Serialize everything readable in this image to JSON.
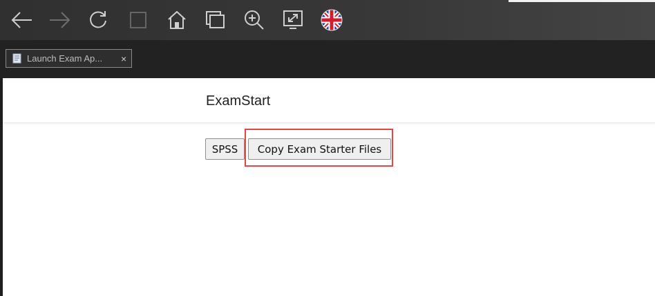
{
  "browser": {
    "toolbar": {
      "icons": [
        "back-arrow-icon",
        "forward-arrow-icon",
        "reload-icon",
        "stop-icon",
        "home-icon",
        "windows-icon",
        "zoom-in-icon",
        "fullscreen-icon",
        "uk-flag-icon"
      ]
    },
    "tabs": [
      {
        "title": "Launch Exam Ap...",
        "close_label": "×",
        "active": true
      }
    ]
  },
  "page": {
    "title": "ExamStart",
    "buttons": {
      "spss_label": "SPSS",
      "copy_label": "Copy Exam Starter Files"
    },
    "highlight_color": "#e04848"
  }
}
